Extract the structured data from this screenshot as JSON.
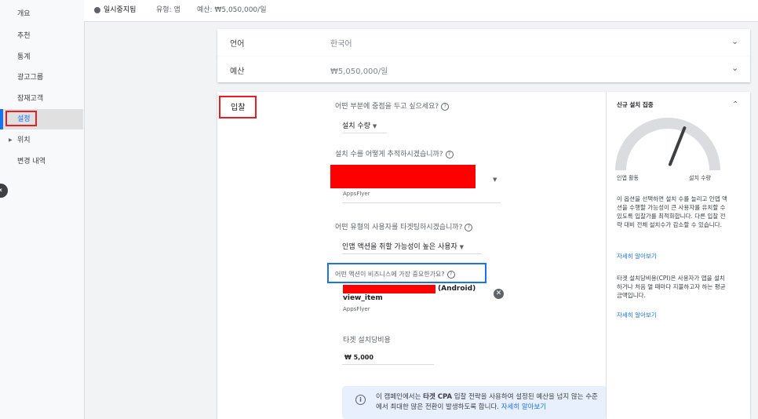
{
  "sidebar": {
    "items": [
      {
        "label": "개요"
      },
      {
        "label": "추천"
      },
      {
        "label": "통계"
      },
      {
        "label": "광고그룹"
      },
      {
        "label": "잠재고객"
      },
      {
        "label": "설정"
      },
      {
        "label": "위치"
      },
      {
        "label": "변경 내역"
      }
    ],
    "collapse_icon": "chevron-left-icon"
  },
  "topbar": {
    "status": "일시중지됨",
    "type": "유형: 앱",
    "budget": "예산: ₩5,050,000/일"
  },
  "language_row": {
    "label": "언어",
    "value": "한국어"
  },
  "budget_row": {
    "label": "예산",
    "value": "₩5,050,000/일"
  },
  "bidding": {
    "label": "입찰",
    "focus_question": "어떤 부분에 중점을 두고 싶으세요?",
    "focus_value": "설치 수량",
    "track_question": "설치 수를 어떻게 추적하시겠습니까?",
    "track_source": "AppsFlyer",
    "target_user_question": "어떤 유형의 사용자를 타겟팅하시겠습니까?",
    "target_user_value": "인앱 액션을 취할 가능성이 높은 사용자",
    "action_question": "어떤 액션이 비즈니스에 가장 중요한가요?",
    "action_platform": "(Android)",
    "action_event": "view_item",
    "action_source": "AppsFlyer",
    "target_cpi_label": "타겟 설치당비용",
    "target_cpi_value": "₩ 5,000",
    "info_text_pre": "이 캠페인에서는 ",
    "info_text_bold": "타겟 CPA",
    "info_text_post": " 입찰 전략을 사용하여 설정된 예산을 넘지 않는 수준에서 최대한 많은 전환이 발생하도록 합니다. ",
    "info_link": "자세히 알아보기"
  },
  "side_panel": {
    "title": "신규 설치 집중",
    "gauge_left": "인앱 활동",
    "gauge_right": "설치 수량",
    "gauge_value_fraction": 0.62,
    "desc1": "이 옵션을 선택하면 설치 수를 늘리고 인앱 액션을 수행할 가능성이 큰 사용자를 유치할 수 있도록 입찰가를 최적화합니다. 다른 입찰 전략 대비 전체 설치수가 감소할 수 있습니다.",
    "link1": "자세히 알아보기",
    "desc2": "타겟 설치당비용(CPI)은 사용자가 앱을 설치하거나 처음 열 때마다 지불하고자 하는 평균 금액입니다.",
    "link2": "자세히 알아보기"
  },
  "colors": {
    "accent": "#1a73e8",
    "highlight_red": "#ea1d25",
    "highlight_blue": "#1a73e8",
    "redaction": "#ff0000"
  }
}
